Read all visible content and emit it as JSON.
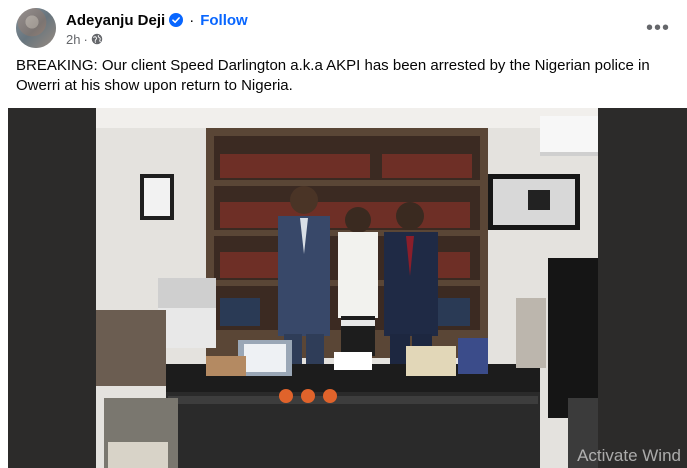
{
  "post": {
    "author_name": "Adeyanju Deji",
    "separator": "·",
    "follow_label": "Follow",
    "time": "2h",
    "text_line1": "BREAKING: Our client Speed Darlington a.k.a AKPI has been arrested by the Nigerian police in",
    "text_line2": "Owerri at his show upon return to Nigeria."
  },
  "overlay": {
    "watermark": "Activate Wind"
  },
  "colors": {
    "follow": "#0866ff",
    "verified": "#0866ff",
    "secondary_text": "#65676b"
  },
  "icons": {
    "verified": "verified-badge-icon",
    "audience": "globe-icon",
    "more": "more-options-icon"
  }
}
